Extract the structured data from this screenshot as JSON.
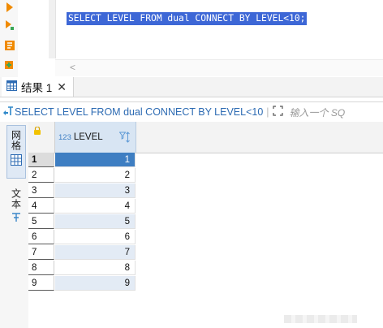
{
  "editor": {
    "sql_text": "SELECT LEVEL FROM dual CONNECT BY LEVEL<10;",
    "scroll_left_arrow": "<"
  },
  "results_tab": {
    "label": "结果 1",
    "close": "✕"
  },
  "filter_bar": {
    "query": "SELECT LEVEL FROM dual CONNECT BY LEVEL<10",
    "separator": "|",
    "input_placeholder": "输入一个 SQ"
  },
  "side_panel": {
    "grid_label": "网格",
    "text_label": "文本"
  },
  "grid": {
    "column": {
      "type_badge": "123",
      "name": "LEVEL"
    },
    "rows": [
      {
        "rownum": "1",
        "value": "1"
      },
      {
        "rownum": "2",
        "value": "2"
      },
      {
        "rownum": "3",
        "value": "3"
      },
      {
        "rownum": "4",
        "value": "4"
      },
      {
        "rownum": "5",
        "value": "5"
      },
      {
        "rownum": "6",
        "value": "6"
      },
      {
        "rownum": "7",
        "value": "7"
      },
      {
        "rownum": "8",
        "value": "8"
      },
      {
        "rownum": "9",
        "value": "9"
      }
    ],
    "selected_row": 1
  },
  "colors": {
    "selection": "#3d67d6",
    "header_accent": "#d8e5f3",
    "alt_row": "#e3ebf5",
    "filter_text": "#2d6bb3"
  },
  "icons": {
    "execute": "play-icon",
    "execute_script": "play-script-icon",
    "explain": "explain-plan-icon",
    "load": "load-icon",
    "result_grid": "grid-icon",
    "lock": "lock-icon",
    "sort": "sort-filter-icon",
    "expand": "expand-icon"
  }
}
